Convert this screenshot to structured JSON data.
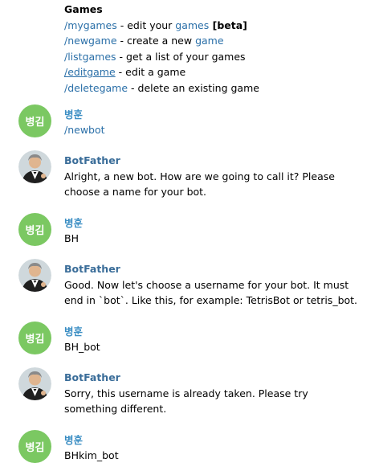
{
  "games": {
    "title": "Games",
    "commands": [
      {
        "cmd": "/mygames",
        "desc_pre": " - edit your ",
        "desc_link": "games",
        "desc_bold": " [beta]",
        "desc_post": ""
      },
      {
        "cmd": "/newgame",
        "desc_pre": " - create a new ",
        "desc_link": "game",
        "desc_bold": "",
        "desc_post": ""
      },
      {
        "cmd": "/listgames",
        "desc_pre": " - get a list of your games",
        "desc_link": "",
        "desc_bold": "",
        "desc_post": ""
      },
      {
        "cmd": "/editgame",
        "desc_pre": " - edit a game",
        "desc_link": "",
        "desc_bold": "",
        "desc_post": ""
      },
      {
        "cmd": "/deletegame",
        "desc_pre": " - delete an existing game",
        "desc_link": "",
        "desc_bold": "",
        "desc_post": ""
      }
    ]
  },
  "user": {
    "name": "병훈",
    "avatar_initials": "병김",
    "avatar_color": "#7bc862"
  },
  "bot": {
    "name": "BotFather"
  },
  "messages": [
    {
      "from": "user",
      "text": "/newbot"
    },
    {
      "from": "bot",
      "text": "Alright, a new bot. How are we going to call it? Please choose a name for your bot."
    },
    {
      "from": "user",
      "text": "BH"
    },
    {
      "from": "bot",
      "text": "Good. Now let's choose a username for your bot. It must end in `bot`. Like this, for example: TetrisBot or tetris_bot."
    },
    {
      "from": "user",
      "text": "BH_bot"
    },
    {
      "from": "bot",
      "text": "Sorry, this username is already taken. Please try something different."
    },
    {
      "from": "user",
      "text": "BHkim_bot"
    }
  ],
  "colors": {
    "link": "#2a6fa8",
    "user_name": "#3d8fc4",
    "bot_name": "#3a6d99",
    "avatar_green": "#7bc862"
  }
}
